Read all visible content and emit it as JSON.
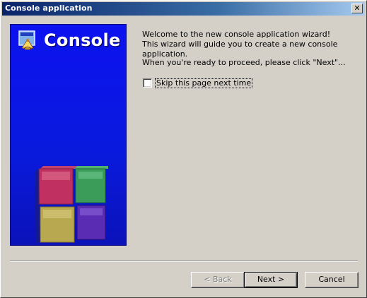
{
  "window": {
    "title": "Console application",
    "close_glyph": "✕"
  },
  "banner": {
    "title": "Console",
    "logo_icon": "codeblocks-logo-icon",
    "background_color": "#0a1adc"
  },
  "content": {
    "welcome_line1": "Welcome to the new console application wizard!",
    "welcome_line2": "This wizard will guide you to create a new console application.",
    "proceed_line": "When you're ready to proceed, please click \"Next\"...",
    "skip_checkbox_label": "Skip this page next time",
    "skip_checked": false
  },
  "buttons": {
    "back": {
      "label": "< Back",
      "mnemonic": "B",
      "enabled": false
    },
    "next": {
      "label": "Next >",
      "mnemonic": "N",
      "enabled": true,
      "default": true
    },
    "cancel": {
      "label": "Cancel",
      "mnemonic": "C",
      "enabled": true
    }
  }
}
